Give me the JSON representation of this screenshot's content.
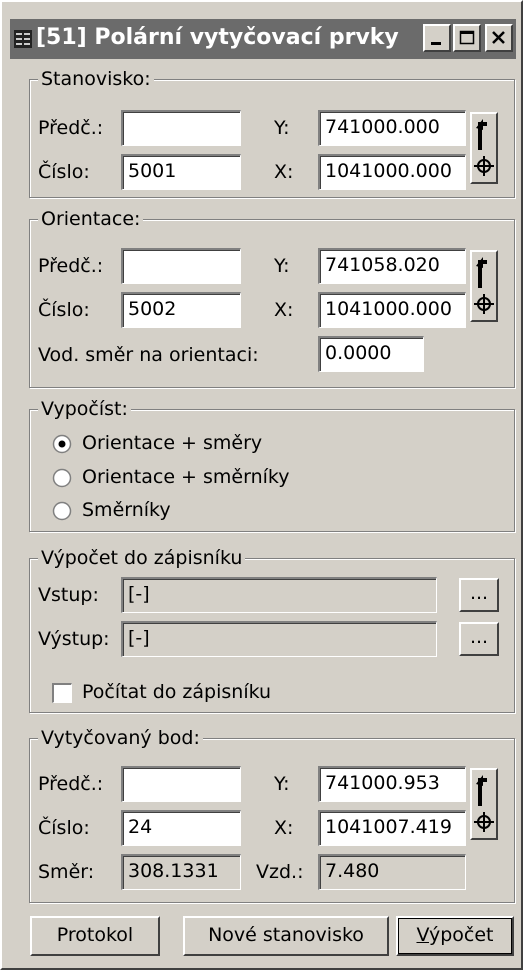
{
  "window": {
    "title": "[51] Polární vytyčovací prvky",
    "controls": [
      "minimize",
      "maximize",
      "close"
    ]
  },
  "stanovisko": {
    "legend": "Stanovisko:",
    "predc_label": "Předč.:",
    "predc_value": "",
    "cislo_label": "Číslo:",
    "cislo_value": "5001",
    "y_label": "Y:",
    "y_value": "741000.000",
    "x_label": "X:",
    "x_value": "1041000.000"
  },
  "orientace": {
    "legend": "Orientace:",
    "predc_label": "Předč.:",
    "predc_value": "",
    "cislo_label": "Číslo:",
    "cislo_value": "5002",
    "y_label": "Y:",
    "y_value": "741058.020",
    "x_label": "X:",
    "x_value": "1041000.000",
    "vod_label": "Vod. směr na orientaci:",
    "vod_value": "0.0000"
  },
  "vypocist": {
    "legend": "Vypočíst:",
    "options": [
      "Orientace + směry",
      "Orientace + směrníky",
      "Směrníky"
    ],
    "selected": "Orientace + směry"
  },
  "zapisnik": {
    "legend": "Výpočet do zápisníku",
    "vstup_label": "Vstup:",
    "vstup_value": "[-]",
    "vystup_label": "Výstup:",
    "vystup_value": "[-]",
    "browse_label": "...",
    "checkbox_label": "Počítat do zápisníku",
    "checkbox_checked": false
  },
  "bod": {
    "legend": "Vytyčovaný bod:",
    "predc_label": "Předč.:",
    "predc_value": "",
    "cislo_label": "Číslo:",
    "cislo_value": "24",
    "y_label": "Y:",
    "y_value": "741000.953",
    "x_label": "X:",
    "x_value": "1041007.419",
    "smer_label": "Směr:",
    "smer_value": "308.1331",
    "vzd_label": "Vzd.:",
    "vzd_value": "7.480"
  },
  "buttons": {
    "protokol": "Protokol",
    "nove": "Nové stanovisko",
    "vypocet_mnemonic": "V",
    "vypocet_rest": "ýpočet"
  },
  "colors": {
    "face": "#d4d0c8",
    "titlebar": "#6b6b6b",
    "field": "#ffffff"
  }
}
